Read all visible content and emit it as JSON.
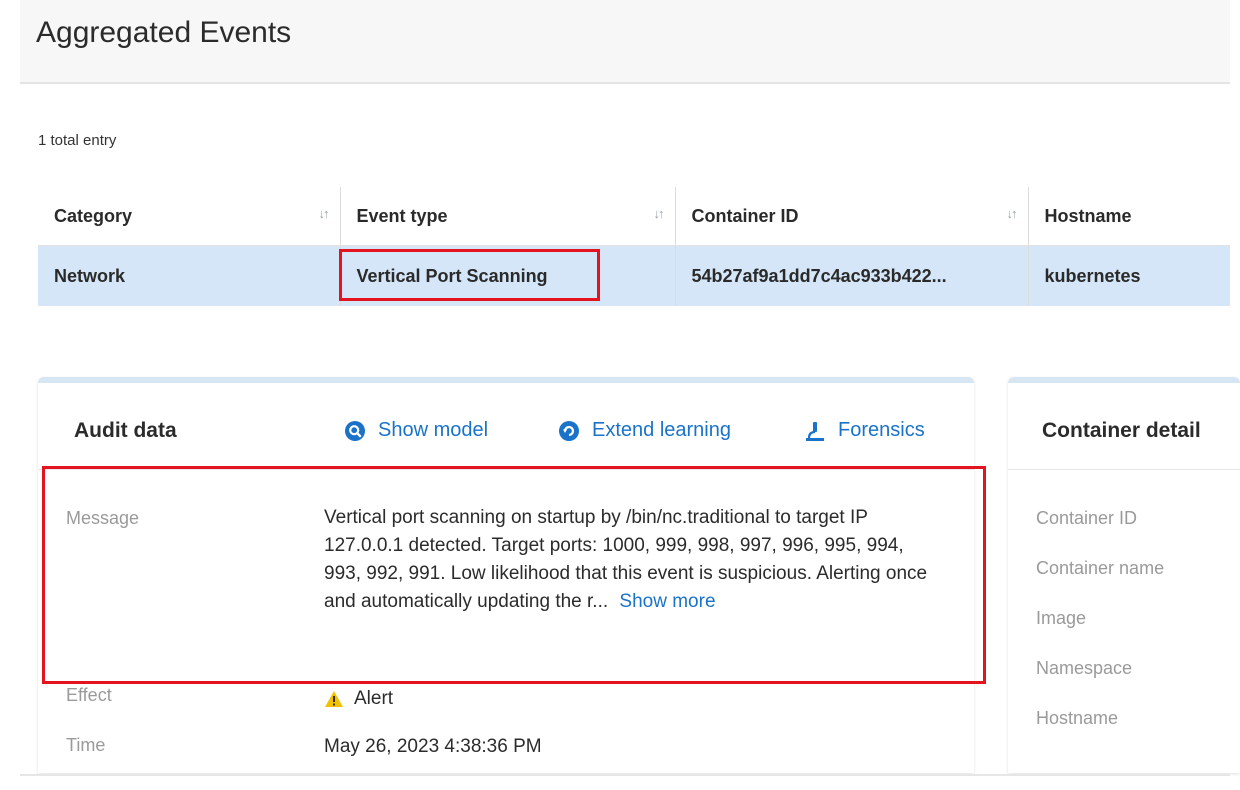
{
  "page": {
    "title": "Aggregated Events",
    "total_entries": "1 total entry"
  },
  "table": {
    "columns": [
      {
        "label": "Category",
        "sortable": true
      },
      {
        "label": "Event type",
        "sortable": true
      },
      {
        "label": "Container ID",
        "sortable": true
      },
      {
        "label": "Hostname",
        "sortable": false
      }
    ],
    "rows": [
      {
        "category": "Network",
        "event_type": "Vertical Port Scanning",
        "container_id": "54b27af9a1dd7c4ac933b422...",
        "hostname": "kubernetes"
      }
    ],
    "sort_icon": "↓↑"
  },
  "audit": {
    "title": "Audit data",
    "actions": {
      "show_model": "Show model",
      "extend_learning": "Extend learning",
      "forensics": "Forensics"
    },
    "fields": {
      "message_label": "Message",
      "message_value": "Vertical port scanning on startup by /bin/nc.traditional to target IP 127.0.0.1 detected. Target ports: 1000, 999, 998, 997, 996, 995, 994, 993, 992, 991. Low likelihood that this event is suspicious. Alerting once and automatically updating the r...",
      "show_more": "Show more",
      "effect_label": "Effect",
      "effect_value": "Alert",
      "time_label": "Time",
      "time_value": "May 26, 2023 4:38:36 PM"
    }
  },
  "container_details": {
    "title": "Container detail",
    "labels": [
      "Container ID",
      "Container name",
      "Image",
      "Namespace",
      "Hostname"
    ]
  },
  "colors": {
    "accent": "#1a73c9",
    "selected_row": "#d4e6f7",
    "highlight": "#e3141f",
    "card_border_top": "#d7e6f3",
    "warning": "#f2c200"
  },
  "icons": [
    "sort-icon",
    "show-model-icon",
    "extend-learning-icon",
    "forensics-icon",
    "warning-icon"
  ]
}
